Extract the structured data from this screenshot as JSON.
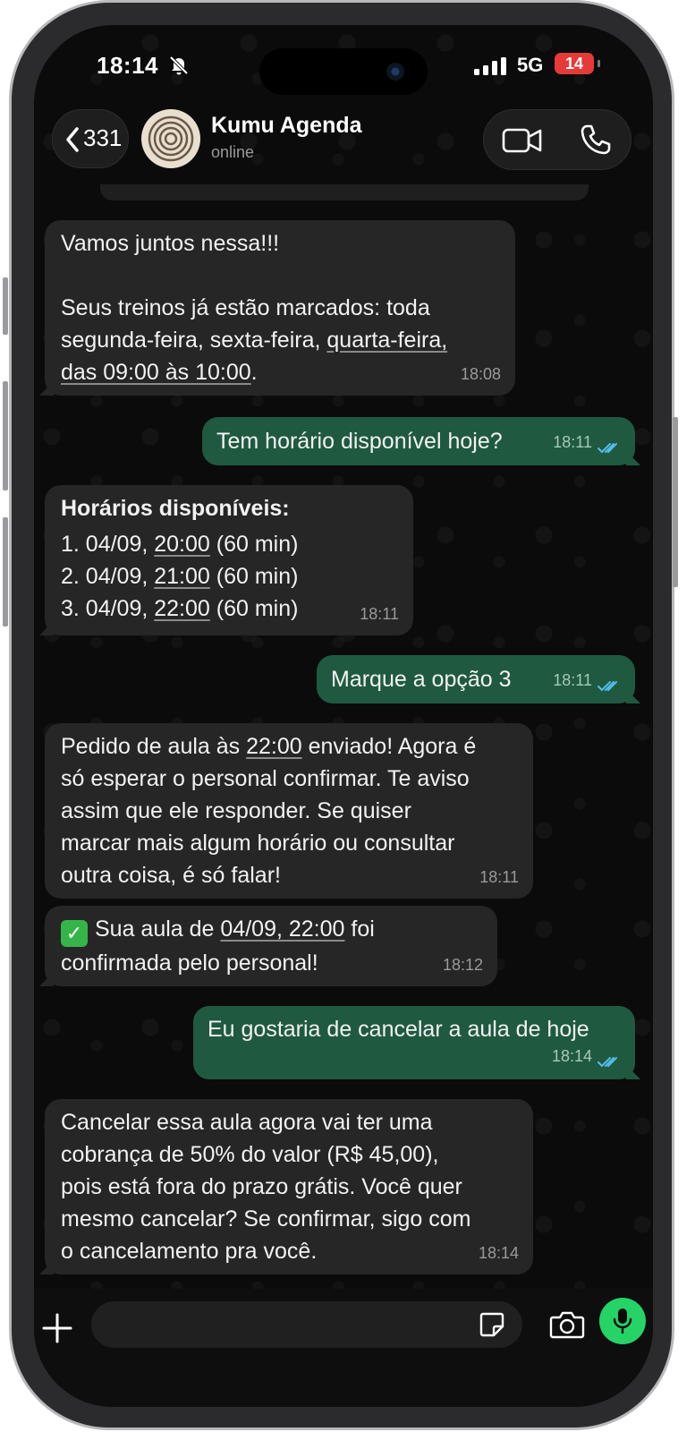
{
  "status_bar": {
    "time": "18:14",
    "network": "5G",
    "battery": "14"
  },
  "header": {
    "back_count": "331",
    "contact_name": "Kumu Agenda",
    "contact_status": "online",
    "video_icon": "video-camera-icon",
    "phone_icon": "phone-icon"
  },
  "messages": [
    {
      "direction": "incoming",
      "line1": "Vamos juntos nessa!!!",
      "line2": "Seus treinos já estão marcados: toda",
      "line3a": "segunda-feira, sexta-feira, ",
      "line3b": "quarta-feira,",
      "line4a": "das 09:00 às 10:00",
      "line4b": ".",
      "time": "18:08"
    },
    {
      "direction": "outgoing",
      "text": "Tem horário disponível hoje?",
      "time": "18:11"
    },
    {
      "direction": "incoming",
      "heading": "Horários disponíveis:",
      "item1a": "1. 04/09, ",
      "item1b": "20:00",
      "item1c": " (60 min)",
      "item2a": "2. 04/09, ",
      "item2b": "21:00",
      "item2c": " (60 min)",
      "item3a": "3. 04/09, ",
      "item3b": "22:00",
      "item3c": " (60 min)",
      "time": "18:11"
    },
    {
      "direction": "outgoing",
      "text": "Marque a opção 3",
      "time": "18:11"
    },
    {
      "direction": "incoming",
      "l1a": "Pedido de aula às ",
      "l1b": "22:00",
      "l1c": " enviado! Agora é",
      "l2": "só esperar o personal confirmar. Te aviso",
      "l3": "assim que ele responder. Se quiser",
      "l4": "marcar mais algum horário ou consultar",
      "l5": "outra coisa, é só falar!",
      "time": "18:11"
    },
    {
      "direction": "incoming",
      "emoji": "✓",
      "l1a": "Sua aula de ",
      "l1b": "04/09, 22:00",
      "l1c": " foi",
      "l2": "confirmada pelo personal!",
      "time": "18:12"
    },
    {
      "direction": "outgoing",
      "text": "Eu gostaria de cancelar a aula de hoje",
      "time": "18:14"
    },
    {
      "direction": "incoming",
      "l1": "Cancelar essa aula agora vai ter uma",
      "l2": "cobrança de 50% do valor (R$ 45,00),",
      "l3": "pois está fora do prazo grátis. Você quer",
      "l4": "mesmo cancelar? Se confirmar, sigo com",
      "l5": "o cancelamento pra você.",
      "time": "18:14"
    }
  ],
  "composer": {
    "placeholder": ""
  },
  "colors": {
    "incoming_bubble": "#262626",
    "outgoing_bubble": "#1f5a40",
    "mic_button": "#25d366",
    "read_ticks": "#53bdeb",
    "battery_low": "#e63a3a"
  }
}
